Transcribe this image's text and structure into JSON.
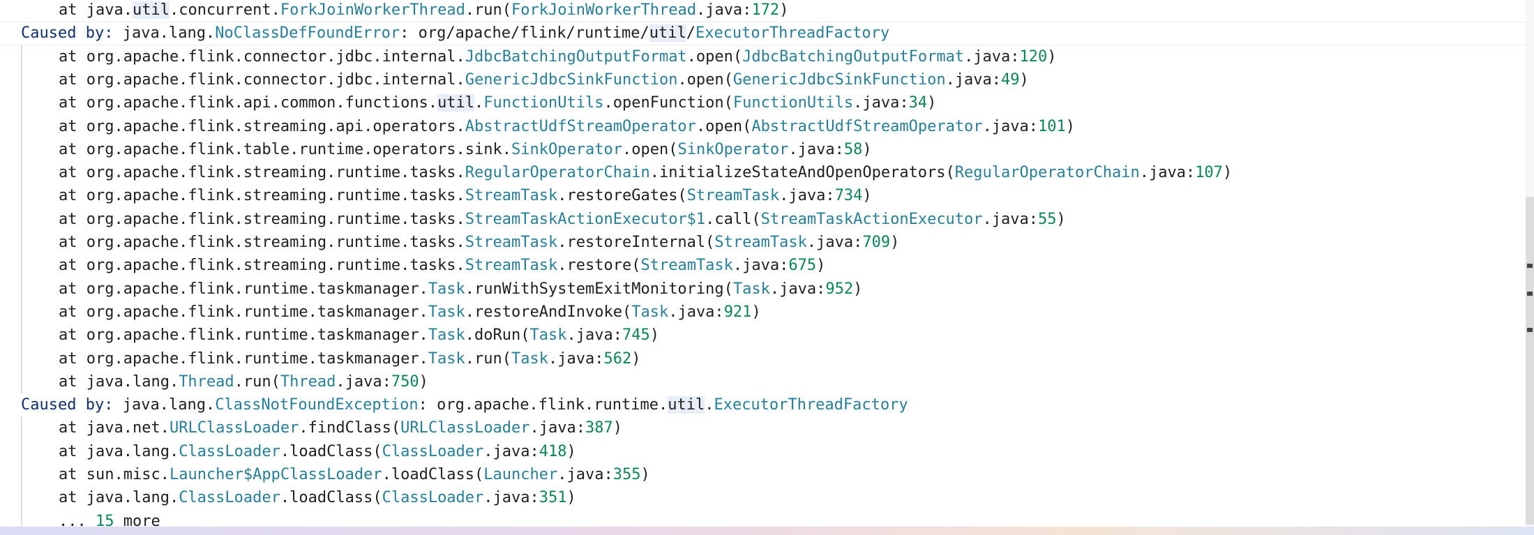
{
  "lines": [
    {
      "kind": "at",
      "parts": [
        "at java.",
        [
          "util",
          "hl"
        ],
        ".concurrent.",
        [
          "ForkJoinWorkerThread",
          "c"
        ],
        ".run(",
        [
          "ForkJoinWorkerThread",
          "c"
        ],
        ".java:",
        [
          "172",
          "n"
        ],
        ")"
      ]
    },
    {
      "kind": "caused",
      "parts": [
        [
          "Caused",
          "b"
        ],
        " ",
        [
          "by:",
          "b"
        ],
        " java.lang.",
        [
          "NoClassDefFoundError",
          "c"
        ],
        ": org/apache/flink/runtime/",
        [
          "CARET",
          "caret"
        ],
        [
          "util",
          "hl"
        ],
        "/",
        [
          "ExecutorThreadFactory",
          "c"
        ]
      ]
    },
    {
      "kind": "at",
      "parts": [
        "at org.apache.flink.connector.jdbc.internal.",
        [
          "JdbcBatchingOutputFormat",
          "c"
        ],
        ".open(",
        [
          "JdbcBatchingOutputFormat",
          "c"
        ],
        ".java:",
        [
          "120",
          "n"
        ],
        ")"
      ]
    },
    {
      "kind": "at",
      "parts": [
        "at org.apache.flink.connector.jdbc.internal.",
        [
          "GenericJdbcSinkFunction",
          "c"
        ],
        ".open(",
        [
          "GenericJdbcSinkFunction",
          "c"
        ],
        ".java:",
        [
          "49",
          "n"
        ],
        ")"
      ]
    },
    {
      "kind": "at",
      "parts": [
        "at org.apache.flink.api.common.functions.",
        [
          "util",
          "hl"
        ],
        ".",
        [
          "FunctionUtils",
          "c"
        ],
        ".openFunction(",
        [
          "FunctionUtils",
          "c"
        ],
        ".java:",
        [
          "34",
          "n"
        ],
        ")"
      ]
    },
    {
      "kind": "at",
      "parts": [
        "at org.apache.flink.streaming.api.operators.",
        [
          "AbstractUdfStreamOperator",
          "c"
        ],
        ".open(",
        [
          "AbstractUdfStreamOperator",
          "c"
        ],
        ".java:",
        [
          "101",
          "n"
        ],
        ")"
      ]
    },
    {
      "kind": "at",
      "parts": [
        "at org.apache.flink.table.runtime.operators.sink.",
        [
          "SinkOperator",
          "c"
        ],
        ".open(",
        [
          "SinkOperator",
          "c"
        ],
        ".java:",
        [
          "58",
          "n"
        ],
        ")"
      ]
    },
    {
      "kind": "at",
      "parts": [
        "at org.apache.flink.streaming.runtime.tasks.",
        [
          "RegularOperatorChain",
          "c"
        ],
        ".initializeStateAndOpenOperators(",
        [
          "RegularOperatorChain",
          "c"
        ],
        ".java:",
        [
          "107",
          "n"
        ],
        ")"
      ]
    },
    {
      "kind": "at",
      "parts": [
        "at org.apache.flink.streaming.runtime.tasks.",
        [
          "StreamTask",
          "c"
        ],
        ".restoreGates(",
        [
          "StreamTask",
          "c"
        ],
        ".java:",
        [
          "734",
          "n"
        ],
        ")"
      ]
    },
    {
      "kind": "at",
      "parts": [
        "at org.apache.flink.streaming.runtime.tasks.",
        [
          "StreamTaskActionExecutor$1",
          "c"
        ],
        ".call(",
        [
          "StreamTaskActionExecutor",
          "c"
        ],
        ".java:",
        [
          "55",
          "n"
        ],
        ")"
      ]
    },
    {
      "kind": "at",
      "parts": [
        "at org.apache.flink.streaming.runtime.tasks.",
        [
          "StreamTask",
          "c"
        ],
        ".restoreInternal(",
        [
          "StreamTask",
          "c"
        ],
        ".java:",
        [
          "709",
          "n"
        ],
        ")"
      ]
    },
    {
      "kind": "at",
      "parts": [
        "at org.apache.flink.streaming.runtime.tasks.",
        [
          "StreamTask",
          "c"
        ],
        ".restore(",
        [
          "StreamTask",
          "c"
        ],
        ".java:",
        [
          "675",
          "n"
        ],
        ")"
      ]
    },
    {
      "kind": "at",
      "parts": [
        "at org.apache.flink.runtime.taskmanager.",
        [
          "Task",
          "c"
        ],
        ".runWithSystemExitMonitoring(",
        [
          "Task",
          "c"
        ],
        ".java:",
        [
          "952",
          "n"
        ],
        ")"
      ]
    },
    {
      "kind": "at",
      "parts": [
        "at org.apache.flink.runtime.taskmanager.",
        [
          "Task",
          "c"
        ],
        ".restoreAndInvoke(",
        [
          "Task",
          "c"
        ],
        ".java:",
        [
          "921",
          "n"
        ],
        ")"
      ]
    },
    {
      "kind": "at",
      "parts": [
        "at org.apache.flink.runtime.taskmanager.",
        [
          "Task",
          "c"
        ],
        ".doRun(",
        [
          "Task",
          "c"
        ],
        ".java:",
        [
          "745",
          "n"
        ],
        ")"
      ]
    },
    {
      "kind": "at",
      "parts": [
        "at org.apache.flink.runtime.taskmanager.",
        [
          "Task",
          "c"
        ],
        ".run(",
        [
          "Task",
          "c"
        ],
        ".java:",
        [
          "562",
          "n"
        ],
        ")"
      ]
    },
    {
      "kind": "at",
      "parts": [
        "at java.lang.",
        [
          "Thread",
          "c"
        ],
        ".run(",
        [
          "Thread",
          "c"
        ],
        ".java:",
        [
          "750",
          "n"
        ],
        ")"
      ]
    },
    {
      "kind": "caused",
      "parts": [
        [
          "Caused",
          "b"
        ],
        " ",
        [
          "by:",
          "b"
        ],
        " java.lang.",
        [
          "ClassNotFoundException",
          "c"
        ],
        ": org.apache.flink.runtime.",
        [
          "util",
          "hl"
        ],
        ".",
        [
          "ExecutorThreadFactory",
          "c"
        ]
      ]
    },
    {
      "kind": "at",
      "parts": [
        "at java.net.",
        [
          "URLClassLoader",
          "c"
        ],
        ".findClass(",
        [
          "URLClassLoader",
          "c"
        ],
        ".java:",
        [
          "387",
          "n"
        ],
        ")"
      ]
    },
    {
      "kind": "at",
      "parts": [
        "at java.lang.",
        [
          "ClassLoader",
          "c"
        ],
        ".loadClass(",
        [
          "ClassLoader",
          "c"
        ],
        ".java:",
        [
          "418",
          "n"
        ],
        ")"
      ]
    },
    {
      "kind": "at",
      "parts": [
        "at sun.misc.",
        [
          "Launcher$AppClassLoader",
          "c"
        ],
        ".loadClass(",
        [
          "Launcher",
          "c"
        ],
        ".java:",
        [
          "355",
          "n"
        ],
        ")"
      ]
    },
    {
      "kind": "at",
      "parts": [
        "at java.lang.",
        [
          "ClassLoader",
          "c"
        ],
        ".loadClass(",
        [
          "ClassLoader",
          "c"
        ],
        ".java:",
        [
          "351",
          "n"
        ],
        ")"
      ]
    },
    {
      "kind": "at",
      "parts": [
        "... ",
        [
          "15",
          "n"
        ],
        " more"
      ]
    }
  ],
  "colors": {
    "text": "#1f1f1f",
    "class": "#267f99",
    "number": "#098658",
    "keyword": "#0e2f6e",
    "highlight": "#e8eef8"
  }
}
